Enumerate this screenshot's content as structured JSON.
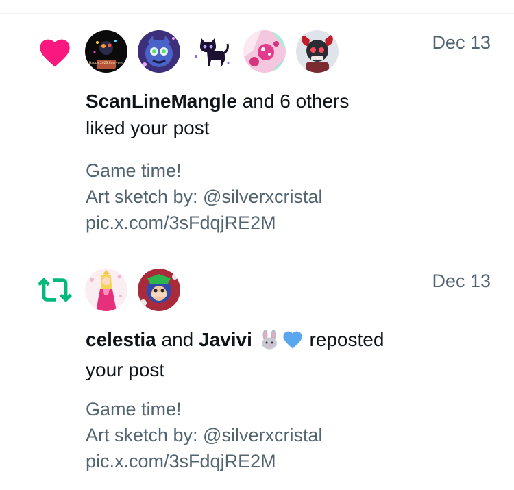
{
  "notifications": [
    {
      "type": "like",
      "icon": "heart-icon",
      "icon_color": "#f91880",
      "avatars": [
        "avatar-scanlinemangle",
        "avatar-blue-animatronic",
        "avatar-black-cat",
        "avatar-pink-abstract",
        "avatar-horned-character"
      ],
      "date": "Dec 13",
      "actor_name": "ScanLineMangle",
      "action_rest": " and 6 others",
      "action_line2": "liked your post",
      "post_lines": [
        "Game time!",
        "Art sketch by: @silverxcristal",
        "pic.x.com/3sFdqjRE2M"
      ],
      "avatar_caption": "Happy 2023 Everyone"
    },
    {
      "type": "repost",
      "icon": "repost-icon",
      "icon_color": "#00ba7c",
      "avatars": [
        "avatar-celestia",
        "avatar-javivi"
      ],
      "date": "Dec 13",
      "actor_name_1": "celestia",
      "connector": " and ",
      "actor_name_2": "Javivi",
      "emojis": [
        "rabbit-emoji",
        "blue-heart-emoji"
      ],
      "action_rest": " reposted",
      "action_line2": "your post",
      "post_lines": [
        "Game time!",
        "Art sketch by: @silverxcristal",
        "pic.x.com/3sFdqjRE2M"
      ]
    }
  ]
}
